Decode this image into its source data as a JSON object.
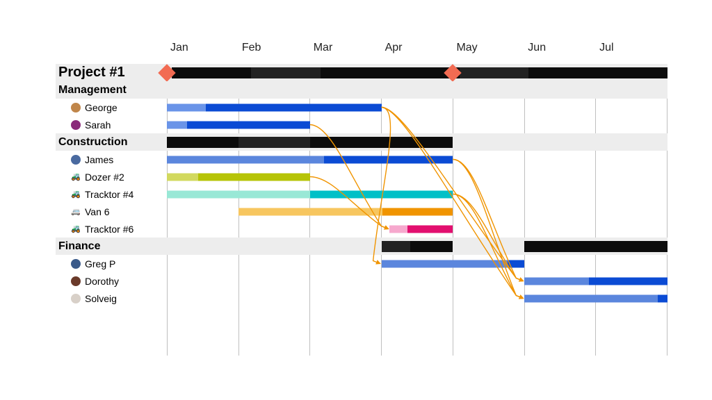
{
  "chart_data": {
    "type": "gantt",
    "months": [
      "Jan",
      "Feb",
      "Mar",
      "Apr",
      "May",
      "Jun",
      "Jul"
    ],
    "month_width_pct": 14.2857,
    "milestones": [
      {
        "row": "project",
        "month_pct": 0
      },
      {
        "row": "project",
        "month_pct": 57.14
      }
    ],
    "rows": [
      {
        "id": "project",
        "kind": "project",
        "label": "Project #1",
        "bars": [
          {
            "start": 1,
            "end": 100,
            "height": "thick",
            "segs": [
              {
                "c": "#0c0c0c",
                "w": 16
              },
              {
                "c": "#222",
                "w": 14
              },
              {
                "c": "#0c0c0c",
                "w": 28
              },
              {
                "c": "#222",
                "w": 14
              },
              {
                "c": "#0c0c0c",
                "w": 28
              }
            ]
          }
        ]
      },
      {
        "id": "mgmt",
        "kind": "section",
        "label": "Management"
      },
      {
        "id": "george",
        "kind": "item",
        "label": "George",
        "icon": {
          "type": "avatar",
          "bg": "#c0864a"
        },
        "bars": [
          {
            "start": 0,
            "end": 42.86,
            "segs": [
              {
                "c": "#6a94e8",
                "w": 18
              },
              {
                "c": "#0b4bd4",
                "w": 82
              }
            ]
          }
        ]
      },
      {
        "id": "sarah",
        "kind": "item",
        "label": "Sarah",
        "icon": {
          "type": "avatar",
          "bg": "#8a2a7a"
        },
        "bars": [
          {
            "start": 0,
            "end": 28.57,
            "segs": [
              {
                "c": "#6a94e8",
                "w": 14
              },
              {
                "c": "#0b4bd4",
                "w": 86
              }
            ]
          }
        ]
      },
      {
        "id": "constr",
        "kind": "section",
        "label": "Construction",
        "bars": [
          {
            "start": 0,
            "end": 57.14,
            "height": "thick",
            "segs": [
              {
                "c": "#0c0c0c",
                "w": 25
              },
              {
                "c": "#222",
                "w": 25
              },
              {
                "c": "#0c0c0c",
                "w": 50
              }
            ]
          }
        ]
      },
      {
        "id": "james",
        "kind": "item",
        "label": "James",
        "icon": {
          "type": "avatar",
          "bg": "#4a6aa0"
        },
        "bars": [
          {
            "start": 0,
            "end": 57.14,
            "segs": [
              {
                "c": "#5b86dd",
                "w": 55
              },
              {
                "c": "#0b4bd4",
                "w": 45
              }
            ]
          }
        ]
      },
      {
        "id": "dozer",
        "kind": "item",
        "label": "Dozer #2",
        "icon": {
          "type": "emoji",
          "glyph": "🚜",
          "bg": ""
        },
        "bars": [
          {
            "start": 0,
            "end": 28.57,
            "segs": [
              {
                "c": "#d2d95e",
                "w": 22
              },
              {
                "c": "#b6c407",
                "w": 78
              }
            ]
          }
        ]
      },
      {
        "id": "tracktor4",
        "kind": "item",
        "label": "Tracktor #4",
        "icon": {
          "type": "emoji",
          "glyph": "🚜",
          "bg": ""
        },
        "bars": [
          {
            "start": 0,
            "end": 57.14,
            "segs": [
              {
                "c": "#99e8d6",
                "w": 50
              },
              {
                "c": "#00c0c7",
                "w": 50
              }
            ]
          }
        ]
      },
      {
        "id": "van6",
        "kind": "item",
        "label": "Van 6",
        "icon": {
          "type": "emoji",
          "glyph": "🚐",
          "bg": ""
        },
        "bars": [
          {
            "start": 14.29,
            "end": 57.14,
            "segs": [
              {
                "c": "#f7c65f",
                "w": 67
              },
              {
                "c": "#f09400",
                "w": 33
              }
            ]
          }
        ]
      },
      {
        "id": "tracktor6",
        "kind": "item",
        "label": "Tracktor #6",
        "icon": {
          "type": "emoji",
          "glyph": "🚜",
          "bg": ""
        },
        "bars": [
          {
            "start": 44.5,
            "end": 57.14,
            "segs": [
              {
                "c": "#f6a8cd",
                "w": 28
              },
              {
                "c": "#e20f6f",
                "w": 72
              }
            ]
          }
        ]
      },
      {
        "id": "fin",
        "kind": "section",
        "label": "Finance",
        "bars": [
          {
            "start": 42.86,
            "end": 57.14,
            "height": "thick",
            "segs": [
              {
                "c": "#222",
                "w": 40
              },
              {
                "c": "#0c0c0c",
                "w": 60
              }
            ]
          },
          {
            "start": 71.43,
            "end": 100,
            "height": "thick",
            "segs": [
              {
                "c": "#0c0c0c",
                "w": 100
              }
            ]
          }
        ]
      },
      {
        "id": "gregp",
        "kind": "item",
        "label": "Greg P",
        "icon": {
          "type": "avatar",
          "bg": "#3a5a8a"
        },
        "bars": [
          {
            "start": 42.86,
            "end": 71.43,
            "segs": [
              {
                "c": "#5b86dd",
                "w": 88
              },
              {
                "c": "#0b4bd4",
                "w": 12
              }
            ]
          }
        ]
      },
      {
        "id": "dorothy",
        "kind": "item",
        "label": "Dorothy",
        "icon": {
          "type": "avatar",
          "bg": "#6a3a2a"
        },
        "bars": [
          {
            "start": 71.43,
            "end": 100,
            "segs": [
              {
                "c": "#5b86dd",
                "w": 45
              },
              {
                "c": "#0b4bd4",
                "w": 55
              }
            ]
          }
        ]
      },
      {
        "id": "solveig",
        "kind": "item",
        "label": "Solveig",
        "icon": {
          "type": "avatar",
          "bg": "#d8d0c8"
        },
        "bars": [
          {
            "start": 71.43,
            "end": 100,
            "segs": [
              {
                "c": "#5b86dd",
                "w": 93
              },
              {
                "c": "#0b4bd4",
                "w": 7
              }
            ]
          }
        ]
      }
    ],
    "dependencies": [
      {
        "from": "sarah",
        "to": "tracktor6"
      },
      {
        "from": "george",
        "to": "gregp"
      },
      {
        "from": "george",
        "to": "dorothy"
      },
      {
        "from": "george",
        "to": "solveig"
      },
      {
        "from": "dozer",
        "to": "tracktor6"
      },
      {
        "from": "james",
        "to": "dorothy"
      },
      {
        "from": "james",
        "to": "solveig"
      },
      {
        "from": "tracktor4",
        "to": "dorothy"
      },
      {
        "from": "tracktor4",
        "to": "solveig"
      }
    ],
    "dep_color": "#f09400"
  }
}
